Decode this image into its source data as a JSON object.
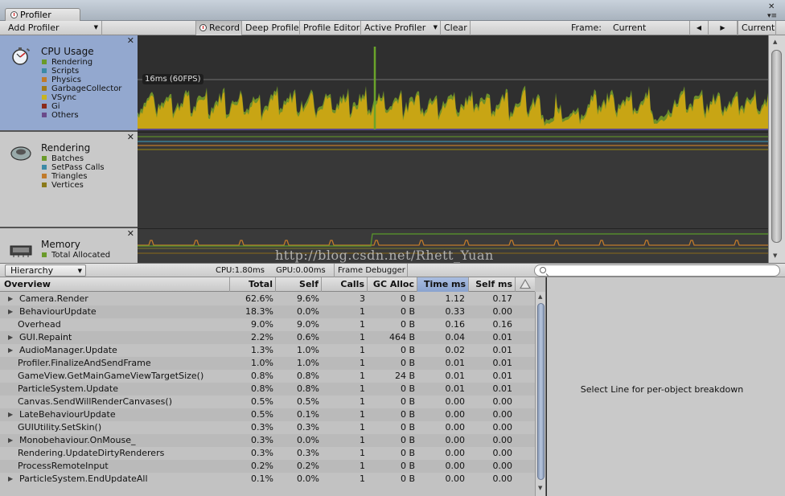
{
  "window": {
    "tab_title": "Profiler",
    "close_glyph": "✕",
    "menu_glyph": "▾≡"
  },
  "toolbar": {
    "add_profiler": "Add Profiler",
    "record": "Record",
    "deep_profile": "Deep Profile",
    "profile_editor": "Profile Editor",
    "active_profiler": "Active Profiler",
    "clear": "Clear",
    "frame_label": "Frame:",
    "frame_value": "Current",
    "prev_glyph": "◀",
    "next_glyph": "▶",
    "current_button": "Current"
  },
  "modules": {
    "cpu": {
      "title": "CPU Usage",
      "legend": [
        {
          "label": "Rendering",
          "color": "#6a9a2a"
        },
        {
          "label": "Scripts",
          "color": "#3c8aa6"
        },
        {
          "label": "Physics",
          "color": "#c07a2a"
        },
        {
          "label": "GarbageCollector",
          "color": "#a07a1a"
        },
        {
          "label": "VSync",
          "color": "#c8b420"
        },
        {
          "label": "Gi",
          "color": "#8a2a1a"
        },
        {
          "label": "Others",
          "color": "#6a4a8a"
        }
      ],
      "fps_label": "16ms (60FPS)"
    },
    "rendering": {
      "title": "Rendering",
      "legend": [
        {
          "label": "Batches",
          "color": "#6a9a2a"
        },
        {
          "label": "SetPass Calls",
          "color": "#3c8aa6"
        },
        {
          "label": "Triangles",
          "color": "#c07a2a"
        },
        {
          "label": "Vertices",
          "color": "#8a7a1a"
        }
      ]
    },
    "memory": {
      "title": "Memory",
      "legend": [
        {
          "label": "Total Allocated",
          "color": "#6a9a2a"
        }
      ]
    }
  },
  "toolbar2": {
    "view_mode": "Hierarchy",
    "cpu_time": "CPU:1.80ms",
    "gpu_time": "GPU:0.00ms",
    "frame_debugger": "Frame Debugger",
    "search_placeholder": ""
  },
  "watermark": "http://blog.csdn.net/Rhett_Yuan",
  "table": {
    "columns": [
      "Overview",
      "Total",
      "Self",
      "Calls",
      "GC Alloc",
      "Time ms",
      "Self ms"
    ],
    "rows": [
      {
        "name": "Camera.Render",
        "fold": true,
        "total": "62.6%",
        "self": "9.6%",
        "calls": "3",
        "gc": "0 B",
        "time": "1.12",
        "self_ms": "0.17"
      },
      {
        "name": "BehaviourUpdate",
        "fold": true,
        "total": "18.3%",
        "self": "0.0%",
        "calls": "1",
        "gc": "0 B",
        "time": "0.33",
        "self_ms": "0.00"
      },
      {
        "name": "Overhead",
        "fold": false,
        "total": "9.0%",
        "self": "9.0%",
        "calls": "1",
        "gc": "0 B",
        "time": "0.16",
        "self_ms": "0.16"
      },
      {
        "name": "GUI.Repaint",
        "fold": true,
        "total": "2.2%",
        "self": "0.6%",
        "calls": "1",
        "gc": "464 B",
        "time": "0.04",
        "self_ms": "0.01"
      },
      {
        "name": "AudioManager.Update",
        "fold": true,
        "total": "1.3%",
        "self": "1.0%",
        "calls": "1",
        "gc": "0 B",
        "time": "0.02",
        "self_ms": "0.01"
      },
      {
        "name": "Profiler.FinalizeAndSendFrame",
        "fold": false,
        "total": "1.0%",
        "self": "1.0%",
        "calls": "1",
        "gc": "0 B",
        "time": "0.01",
        "self_ms": "0.01"
      },
      {
        "name": "GameView.GetMainGameViewTargetSize()",
        "fold": false,
        "total": "0.8%",
        "self": "0.8%",
        "calls": "1",
        "gc": "24 B",
        "time": "0.01",
        "self_ms": "0.01"
      },
      {
        "name": "ParticleSystem.Update",
        "fold": false,
        "total": "0.8%",
        "self": "0.8%",
        "calls": "1",
        "gc": "0 B",
        "time": "0.01",
        "self_ms": "0.01"
      },
      {
        "name": "Canvas.SendWillRenderCanvases()",
        "fold": false,
        "total": "0.5%",
        "self": "0.5%",
        "calls": "1",
        "gc": "0 B",
        "time": "0.00",
        "self_ms": "0.00"
      },
      {
        "name": "LateBehaviourUpdate",
        "fold": true,
        "total": "0.5%",
        "self": "0.1%",
        "calls": "1",
        "gc": "0 B",
        "time": "0.00",
        "self_ms": "0.00"
      },
      {
        "name": "GUIUtility.SetSkin()",
        "fold": false,
        "total": "0.3%",
        "self": "0.3%",
        "calls": "1",
        "gc": "0 B",
        "time": "0.00",
        "self_ms": "0.00"
      },
      {
        "name": "Monobehaviour.OnMouse_",
        "fold": true,
        "total": "0.3%",
        "self": "0.0%",
        "calls": "1",
        "gc": "0 B",
        "time": "0.00",
        "self_ms": "0.00"
      },
      {
        "name": "Rendering.UpdateDirtyRenderers",
        "fold": false,
        "total": "0.3%",
        "self": "0.3%",
        "calls": "1",
        "gc": "0 B",
        "time": "0.00",
        "self_ms": "0.00"
      },
      {
        "name": "ProcessRemoteInput",
        "fold": false,
        "total": "0.2%",
        "self": "0.2%",
        "calls": "1",
        "gc": "0 B",
        "time": "0.00",
        "self_ms": "0.00"
      },
      {
        "name": "ParticleSystem.EndUpdateAll",
        "fold": true,
        "total": "0.1%",
        "self": "0.0%",
        "calls": "1",
        "gc": "0 B",
        "time": "0.00",
        "self_ms": "0.00"
      }
    ]
  },
  "detail": {
    "message": "Select Line for per-object breakdown"
  }
}
